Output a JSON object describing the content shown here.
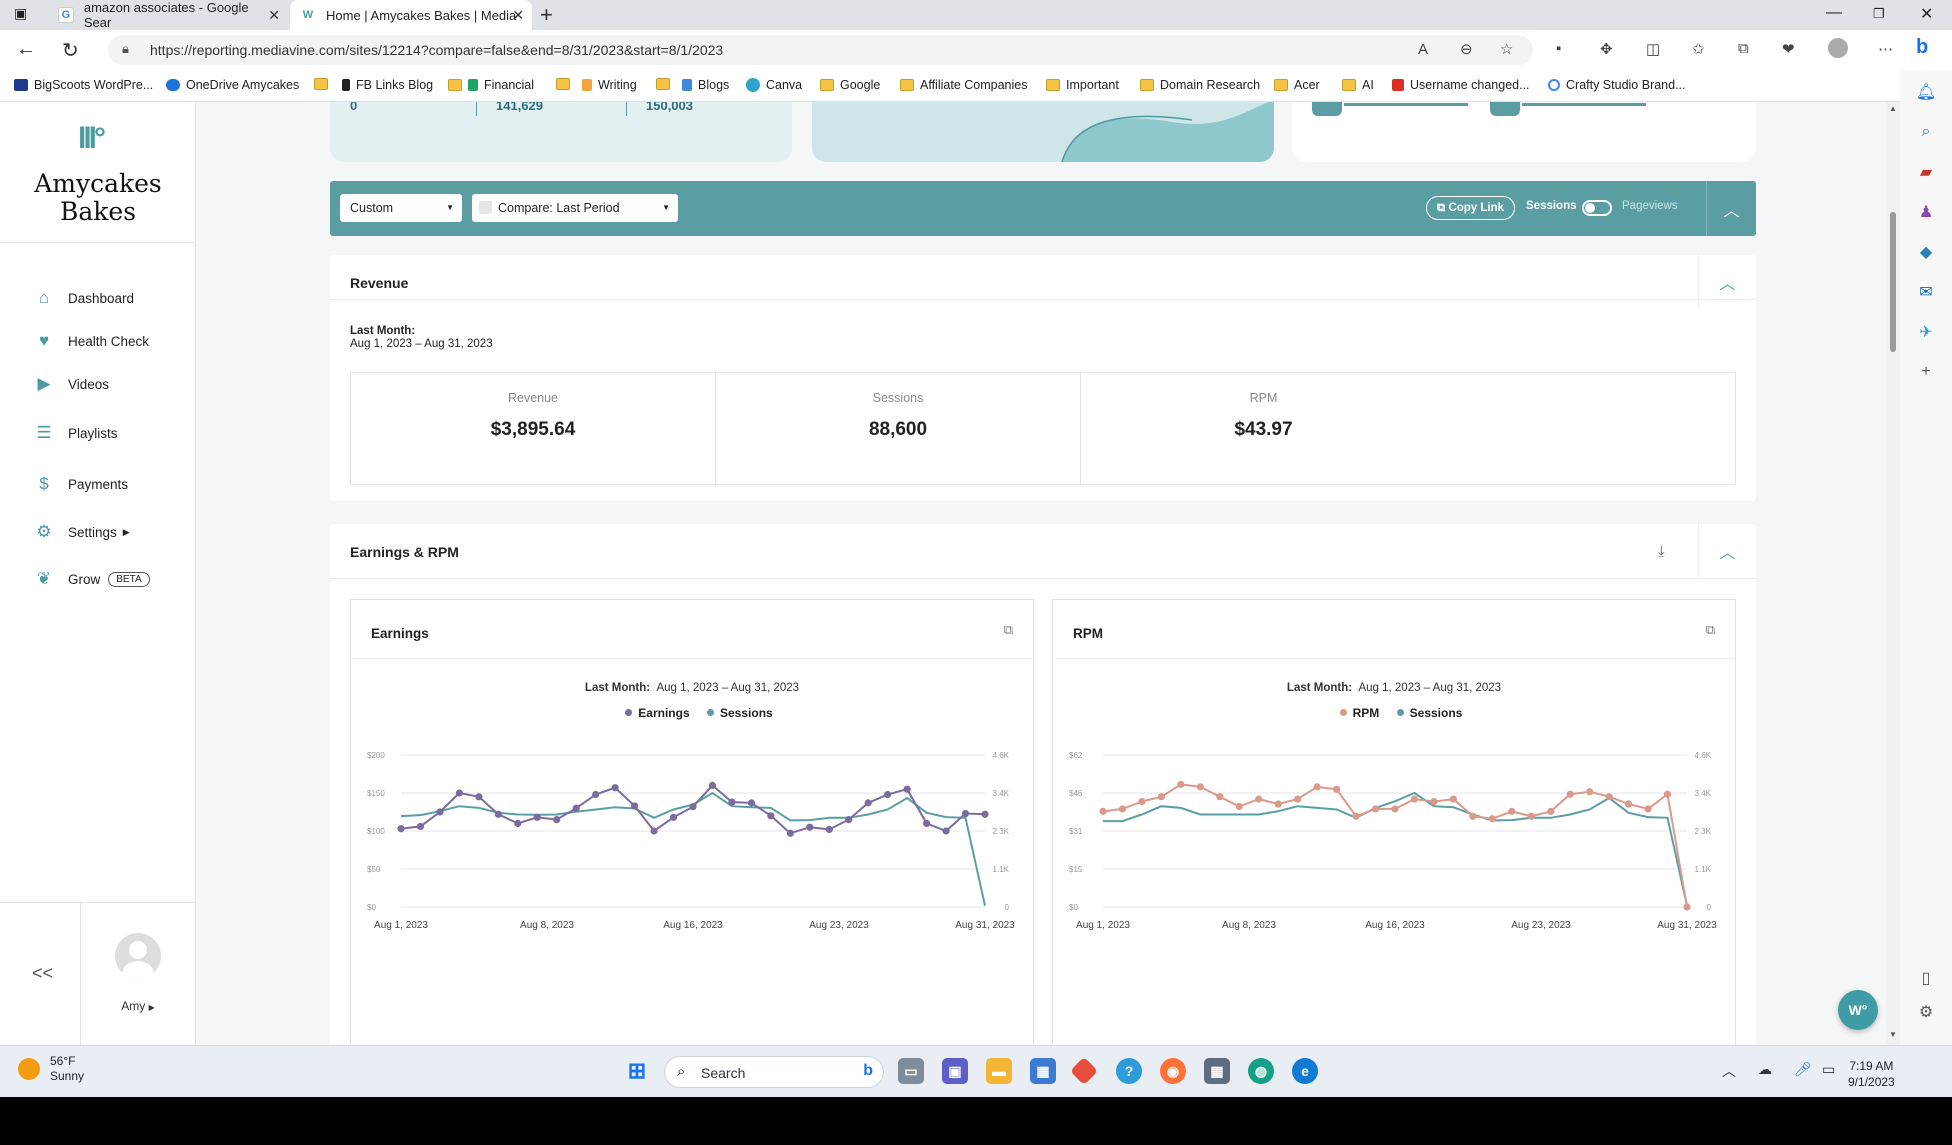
{
  "browser": {
    "tabs": [
      {
        "title": "amazon associates - Google Sear"
      },
      {
        "title": "Home | Amycakes Bakes | Media"
      }
    ],
    "url": "https://reporting.mediavine.com/sites/12214?compare=false&end=8/31/2023&start=8/1/2023",
    "bookmarks": [
      "BigScoots WordPre...",
      "OneDrive Amycakes",
      "",
      "FB Links Blog",
      "Financial",
      "",
      "Writing",
      "",
      "Blogs",
      "Canva",
      "Google",
      "Affiliate Companies",
      "Important",
      "Domain Research",
      "Acer",
      "AI",
      "Username changed...",
      "Crafty Studio Brand..."
    ]
  },
  "sidebar": {
    "brand_line1": "Amycakes",
    "brand_line2": "Bakes",
    "items": [
      {
        "label": "Dashboard",
        "icon": "home-icon"
      },
      {
        "label": "Health Check",
        "icon": "heart-pulse-icon"
      },
      {
        "label": "Videos",
        "icon": "play-icon"
      },
      {
        "label": "Playlists",
        "icon": "list-icon"
      },
      {
        "label": "Payments",
        "icon": "money-bag-icon"
      },
      {
        "label": "Settings",
        "icon": "gear-icon"
      },
      {
        "label": "Grow",
        "icon": "leaf-icon",
        "badge": "BETA"
      }
    ],
    "collapse_label": "<<",
    "user": "Amy"
  },
  "top_stats": {
    "pageviews": [
      {
        "value": "0"
      },
      {
        "value": "141,629"
      },
      {
        "value": "150,003"
      }
    ]
  },
  "filter_bar": {
    "range_select": "Custom",
    "compare_select": "Compare: Last Period",
    "copy_link": "Copy Link",
    "sessions": "Sessions",
    "pageviews": "Pageviews"
  },
  "revenue": {
    "title": "Revenue",
    "period_label": "Last Month:",
    "period_range": "Aug 1, 2023 – Aug 31, 2023",
    "kpis": [
      {
        "label": "Revenue",
        "value": "$3,895.64"
      },
      {
        "label": "Sessions",
        "value": "88,600"
      },
      {
        "label": "RPM",
        "value": "$43.97"
      }
    ]
  },
  "earnings_rpm": {
    "title": "Earnings & RPM",
    "charts": [
      {
        "title": "Earnings",
        "sub_label": "Last Month:",
        "sub_range": "Aug 1, 2023 – Aug 31, 2023",
        "legend": [
          "Earnings",
          "Sessions"
        ]
      },
      {
        "title": "RPM",
        "sub_label": "Last Month:",
        "sub_range": "Aug 1, 2023 – Aug 31, 2023",
        "legend": [
          "RPM",
          "Sessions"
        ]
      }
    ]
  },
  "chart_data": [
    {
      "type": "line",
      "title": "Earnings",
      "x": [
        "Aug 1",
        "Aug 2",
        "Aug 3",
        "Aug 4",
        "Aug 5",
        "Aug 6",
        "Aug 7",
        "Aug 8",
        "Aug 9",
        "Aug 10",
        "Aug 11",
        "Aug 12",
        "Aug 13",
        "Aug 14",
        "Aug 15",
        "Aug 16",
        "Aug 17",
        "Aug 18",
        "Aug 19",
        "Aug 20",
        "Aug 21",
        "Aug 22",
        "Aug 23",
        "Aug 24",
        "Aug 25",
        "Aug 26",
        "Aug 27",
        "Aug 28",
        "Aug 29",
        "Aug 30",
        "Aug 31"
      ],
      "x_tick_labels": [
        "Aug 1, 2023",
        "Aug 8, 2023",
        "Aug 16, 2023",
        "Aug 23, 2023",
        "Aug 31, 2023"
      ],
      "y_left_ticks": [
        "$0",
        "$50",
        "$100",
        "$150",
        "$200"
      ],
      "y_left_range": [
        0,
        200
      ],
      "y_right_ticks": [
        "0",
        "1.1K",
        "2.3K",
        "3.4K",
        "4.6K"
      ],
      "y_right_range": [
        0,
        4600
      ],
      "series": [
        {
          "name": "Earnings",
          "axis": "left",
          "color": "#7b6b9e",
          "values": [
            103,
            106,
            125,
            150,
            145,
            122,
            110,
            118,
            115,
            130,
            148,
            157,
            133,
            100,
            118,
            132,
            160,
            138,
            137,
            120,
            97,
            105,
            102,
            115,
            137,
            148,
            155,
            110,
            100,
            123,
            122
          ]
        },
        {
          "name": "Sessions",
          "axis": "right",
          "color": "#5a9ea4",
          "values": [
            2750,
            2780,
            2900,
            3050,
            3000,
            2850,
            2800,
            2790,
            2800,
            2880,
            2950,
            3020,
            2980,
            2700,
            2950,
            3100,
            3450,
            3050,
            3020,
            3000,
            2620,
            2630,
            2700,
            2700,
            2800,
            2950,
            3300,
            2850,
            2720,
            2700,
            40
          ]
        }
      ]
    },
    {
      "type": "line",
      "title": "RPM",
      "x": [
        "Aug 1",
        "Aug 2",
        "Aug 3",
        "Aug 4",
        "Aug 5",
        "Aug 6",
        "Aug 7",
        "Aug 8",
        "Aug 9",
        "Aug 10",
        "Aug 11",
        "Aug 12",
        "Aug 13",
        "Aug 14",
        "Aug 15",
        "Aug 16",
        "Aug 17",
        "Aug 18",
        "Aug 19",
        "Aug 20",
        "Aug 21",
        "Aug 22",
        "Aug 23",
        "Aug 24",
        "Aug 25",
        "Aug 26",
        "Aug 27",
        "Aug 28",
        "Aug 29",
        "Aug 30",
        "Aug 31"
      ],
      "x_tick_labels": [
        "Aug 1, 2023",
        "Aug 8, 2023",
        "Aug 16, 2023",
        "Aug 23, 2023",
        "Aug 31, 2023"
      ],
      "y_left_ticks": [
        "$0",
        "$15",
        "$31",
        "$46",
        "$62"
      ],
      "y_left_range": [
        0,
        62
      ],
      "y_right_ticks": [
        "0",
        "1.1K",
        "2.3K",
        "3.4K",
        "4.6K"
      ],
      "y_right_range": [
        0,
        4600
      ],
      "series": [
        {
          "name": "RPM",
          "axis": "left",
          "color": "#d99a8a",
          "values": [
            39,
            40,
            43,
            45,
            50,
            49,
            45,
            41,
            44,
            42,
            44,
            49,
            48,
            37,
            40,
            40,
            44,
            43,
            44,
            37,
            36,
            39,
            37,
            39,
            46,
            47,
            45,
            42,
            40,
            46,
            0
          ]
        },
        {
          "name": "Sessions",
          "axis": "right",
          "color": "#5a9ea4",
          "values": [
            2600,
            2600,
            2800,
            3050,
            3000,
            2800,
            2800,
            2800,
            2800,
            2900,
            3050,
            3000,
            2950,
            2700,
            3000,
            3200,
            3450,
            3050,
            3020,
            2800,
            2620,
            2630,
            2700,
            2700,
            2800,
            2950,
            3300,
            2850,
            2720,
            2700,
            40
          ]
        }
      ]
    }
  ],
  "taskbar": {
    "weather_temp": "56°F",
    "weather_desc": "Sunny",
    "search": "Search",
    "time": "7:19 AM",
    "date": "9/1/2023"
  }
}
